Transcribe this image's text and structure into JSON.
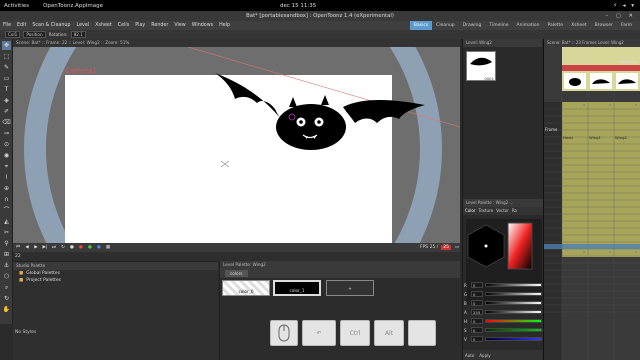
{
  "gnome_bar": {
    "activities": "Activities",
    "app": "OpenToonz.AppImage",
    "clock": "dec 15  11:35"
  },
  "window": {
    "title": "Bat* [portablesandbox] : OpenToonz 1.4 (eXperimental)"
  },
  "menu": [
    "File",
    "Edit",
    "Scan & Cleanup",
    "Level",
    "Xsheet",
    "Cells",
    "Play",
    "Render",
    "View",
    "Windows",
    "Help"
  ],
  "rooms": [
    {
      "label": "Basics",
      "active": true
    },
    {
      "label": "Cleanup"
    },
    {
      "label": "Drawing"
    },
    {
      "label": "Timeline"
    },
    {
      "label": "Animation"
    },
    {
      "label": "Palette"
    },
    {
      "label": "Xsheet"
    },
    {
      "label": "Browser"
    },
    {
      "label": "Farm"
    }
  ],
  "tool_options": {
    "edit_target": "Col1",
    "mode": "Position",
    "rotation_label": "Rotation:",
    "rotation_value": "82.1"
  },
  "viewer": {
    "header": "Scene: Bat*  ::  Frame: 22  ::  Level: Wing2  ::  Zoom: 51%",
    "camera_label": "Camera1"
  },
  "viewer_controls": {
    "fps_label": "FPS 25 /",
    "fps_value": "25"
  },
  "frame_field": {
    "value": "22"
  },
  "style_palette": {
    "header": "Studio Palette",
    "items": [
      {
        "label": "Global Palettes"
      },
      {
        "label": "Project Palettes"
      }
    ],
    "no_styles": "No Styles"
  },
  "level_palette": {
    "header": "Level Palette: Wing2",
    "tab_label": "colors",
    "chips": [
      {
        "label": "color_0"
      },
      {
        "label": "color_1"
      }
    ]
  },
  "keys": [
    "",
    "↶",
    "Ctrl",
    "Alt",
    ""
  ],
  "level_strip": {
    "header": "Level: Wing2",
    "frame_label": "0001"
  },
  "style_editor": {
    "header": "Level Palette : Wing2 ...",
    "tabs": [
      "Color",
      "Texture",
      "Vector",
      "Ra"
    ],
    "channels": [
      {
        "ch": "R",
        "val": "0"
      },
      {
        "ch": "G",
        "val": "0"
      },
      {
        "ch": "B",
        "val": "0"
      },
      {
        "ch": "A",
        "val": "255"
      },
      {
        "ch": "H",
        "val": "0"
      },
      {
        "ch": "S",
        "val": "0"
      },
      {
        "ch": "V",
        "val": "0"
      }
    ],
    "apply": [
      "Auto",
      "Apply"
    ]
  },
  "xsheet": {
    "header": "Scene: Bat*  ::  23 Frames Level: Wing2",
    "frame_header": "Frame",
    "columns": [
      "Head",
      "Wing1",
      "Wing2"
    ],
    "global_key": "Global Key"
  }
}
